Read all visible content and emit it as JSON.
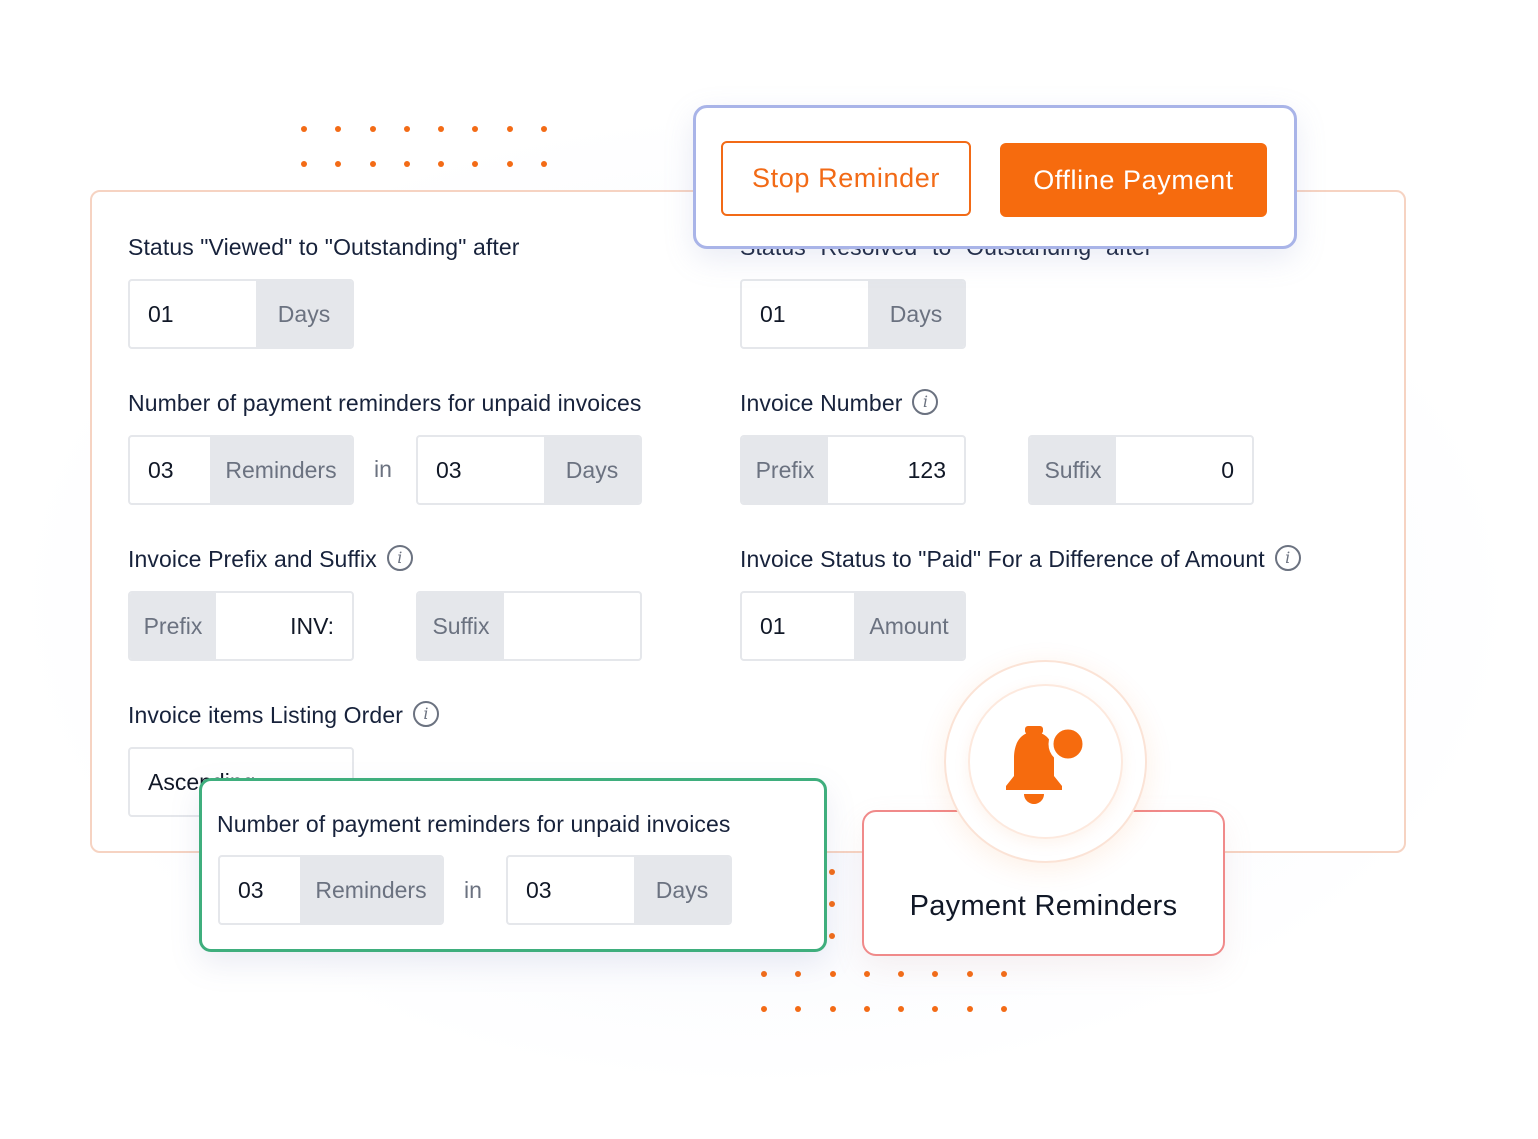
{
  "settings": {
    "viewed_label": "Status \"Viewed\" to \"Outstanding\" after",
    "viewed_value": "01",
    "viewed_unit": "Days",
    "resolved_label": "Status \"Resolved\" to \"Outstanding\" after",
    "resolved_value": "01",
    "resolved_unit": "Days",
    "reminders_label": "Number of payment reminders for unpaid invoices",
    "reminders_count": "03",
    "reminders_unit": "Reminders",
    "in_word": "in",
    "reminders_days": "03",
    "reminders_days_unit": "Days",
    "invoice_number_label": "Invoice Number",
    "invoice_number_prefix_label": "Prefix",
    "invoice_number_prefix_value": "123",
    "invoice_number_suffix_label": "Suffix",
    "invoice_number_suffix_value": "0",
    "prefix_suffix_label": "Invoice Prefix and Suffix",
    "prefix_label": "Prefix",
    "prefix_value": "INV:",
    "suffix_label": "Suffix",
    "suffix_value": "",
    "paid_label": "Invoice Status to \"Paid\" For a Difference of Amount",
    "paid_value": "01",
    "paid_unit": "Amount",
    "listing_order_label": "Invoice items Listing Order",
    "listing_order_value": "Ascending"
  },
  "popup": {
    "stop_reminder": "Stop Reminder",
    "offline_payment": "Offline Payment"
  },
  "highlight": {
    "label": "Number of payment reminders for unpaid invoices",
    "count": "03",
    "unit": "Reminders",
    "in_word": "in",
    "days": "03",
    "days_unit": "Days"
  },
  "feature": {
    "title": "Payment Reminders",
    "icon": "bell-notification-icon"
  },
  "colors": {
    "accent": "#f66b0e",
    "popup_border": "#a9b4e8",
    "highlight_border": "#3fae7d",
    "feature_border": "#f08a8a"
  }
}
